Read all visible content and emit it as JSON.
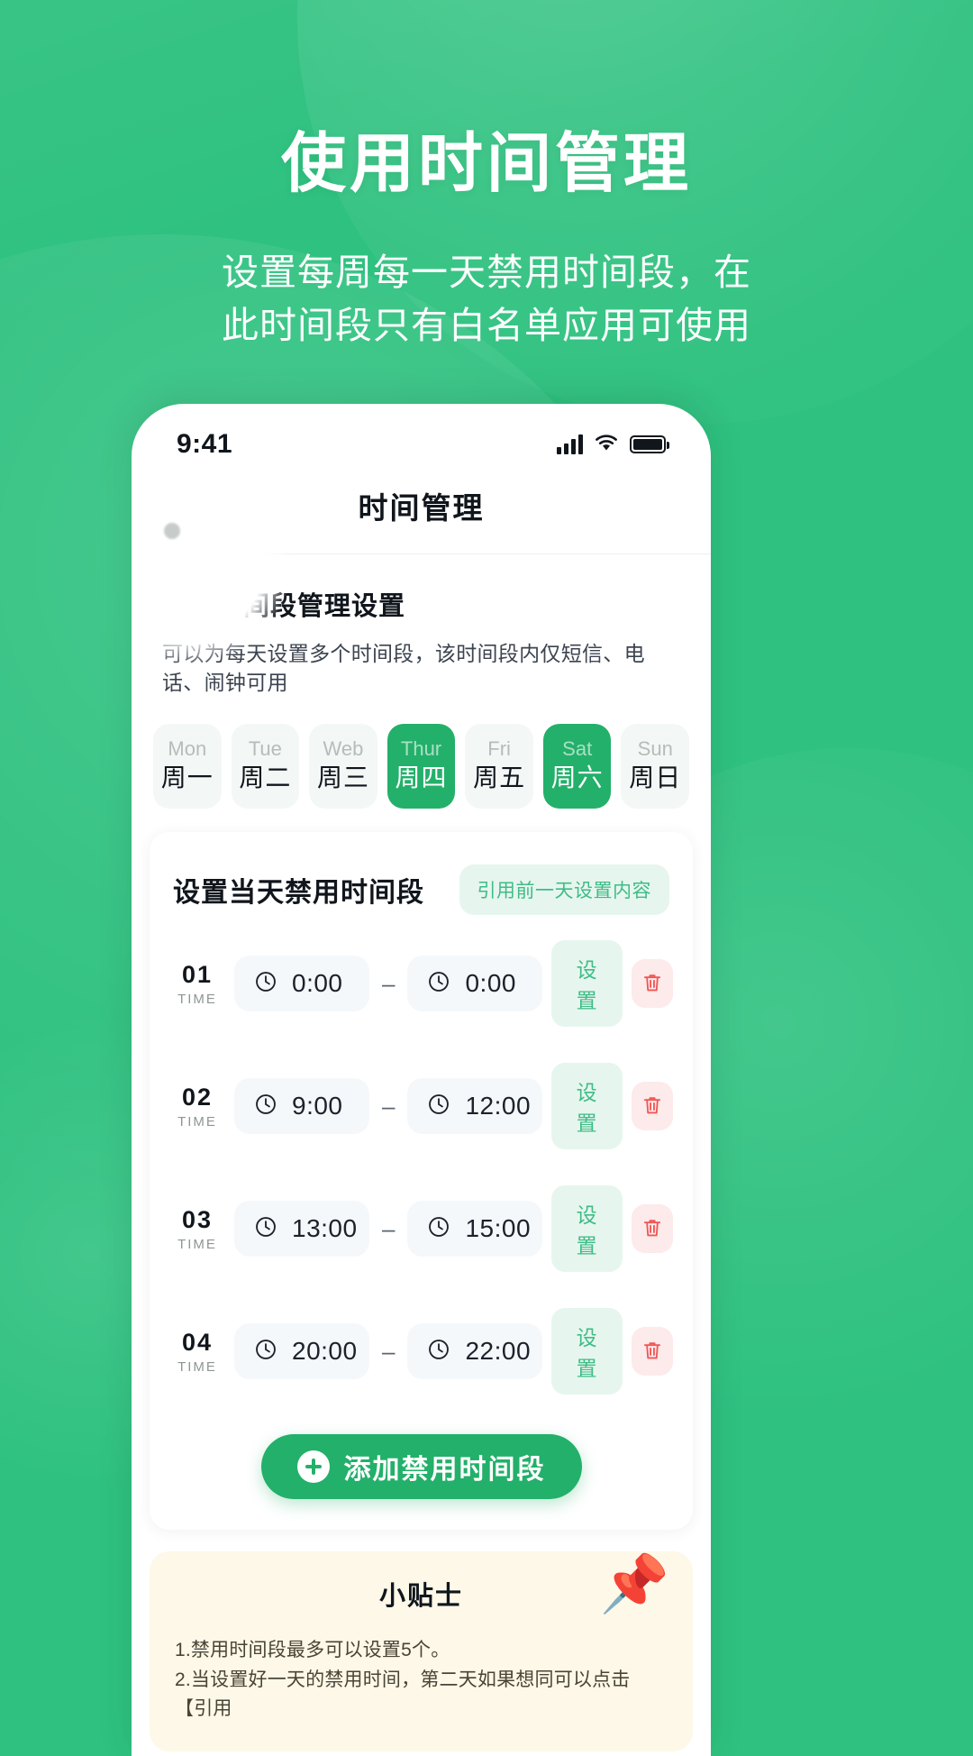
{
  "hero": {
    "title": "使用时间管理",
    "subtitle_line1": "设置每周每一天禁用时间段，在",
    "subtitle_line2": "此时间段只有白名单应用可使用"
  },
  "colors": {
    "brand_green": "#2ec17f",
    "accent_green": "#23b06a",
    "soft_green": "#e6f6ee",
    "tips_bg": "#fdf8e8",
    "delete_red": "#f05656"
  },
  "phone": {
    "statusbar": {
      "time": "9:41",
      "signal_icon": "cellular-signal-icon",
      "wifi_icon": "wifi-icon",
      "battery_icon": "battery-icon"
    },
    "navbar": {
      "title": "时间管理"
    },
    "section": {
      "title": "禁用时间段管理设置",
      "description": "可以为每天设置多个时间段，该时间段内仅短信、电话、闹钟可用"
    },
    "day_tabs": [
      {
        "en": "Mon",
        "cn": "周一",
        "active": false
      },
      {
        "en": "Tue",
        "cn": "周二",
        "active": false
      },
      {
        "en": "Web",
        "cn": "周三",
        "active": false
      },
      {
        "en": "Thur",
        "cn": "周四",
        "active": true
      },
      {
        "en": "Fri",
        "cn": "周五",
        "active": false
      },
      {
        "en": "Sat",
        "cn": "周六",
        "active": true
      },
      {
        "en": "Sun",
        "cn": "周日",
        "active": false
      }
    ],
    "panel": {
      "title": "设置当天禁用时间段",
      "quote_button": "引用前一天设置内容",
      "index_label": "TIME",
      "dash": "–",
      "set_button": "设置",
      "delete_icon": "trash-icon",
      "clock_icon": "clock-icon",
      "rows": [
        {
          "index": "01",
          "start": "0:00",
          "end": "0:00"
        },
        {
          "index": "02",
          "start": "9:00",
          "end": "12:00"
        },
        {
          "index": "03",
          "start": "13:00",
          "end": "15:00"
        },
        {
          "index": "04",
          "start": "20:00",
          "end": "22:00"
        }
      ],
      "add_button": "添加禁用时间段",
      "add_icon": "plus-circle-icon"
    },
    "tips": {
      "heading": "小贴士",
      "pin_icon": "pushpin-icon",
      "items": [
        "1.禁用时间段最多可以设置5个。",
        "2.当设置好一天的禁用时间，第二天如果想同可以点击【引用"
      ]
    }
  }
}
